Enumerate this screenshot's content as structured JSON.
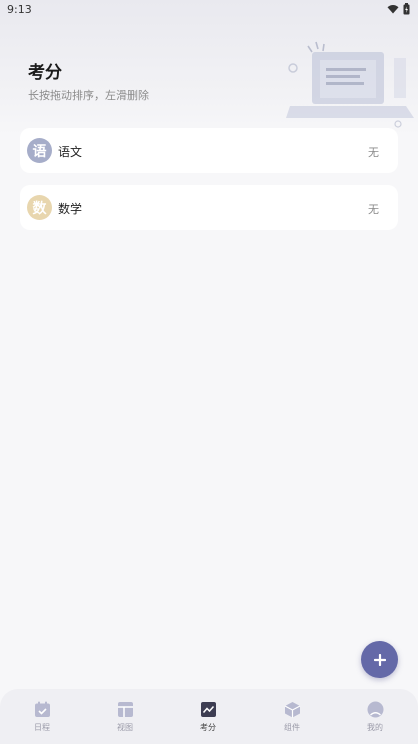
{
  "status_bar": {
    "time": "9:13"
  },
  "header": {
    "title": "考分",
    "subtitle": "长按拖动排序，左滑删除"
  },
  "subjects": [
    {
      "badge": "语",
      "name": "语文",
      "score": "无",
      "badge_color": "#a6adc9"
    },
    {
      "badge": "数",
      "name": "数学",
      "score": "无",
      "badge_color": "#e8d6ae"
    }
  ],
  "fab": {
    "icon": "plus-icon",
    "label": "+"
  },
  "tabs": [
    {
      "label": "日程",
      "icon": "calendar-icon",
      "active": false
    },
    {
      "label": "视图",
      "icon": "layout-icon",
      "active": false
    },
    {
      "label": "考分",
      "icon": "chart-icon",
      "active": true
    },
    {
      "label": "组件",
      "icon": "cube-icon",
      "active": false
    },
    {
      "label": "我的",
      "icon": "person-icon",
      "active": false
    }
  ],
  "colors": {
    "accent": "#6469a8",
    "inactive_icon": "#b7b9d0",
    "active_icon": "#3d3d52"
  }
}
